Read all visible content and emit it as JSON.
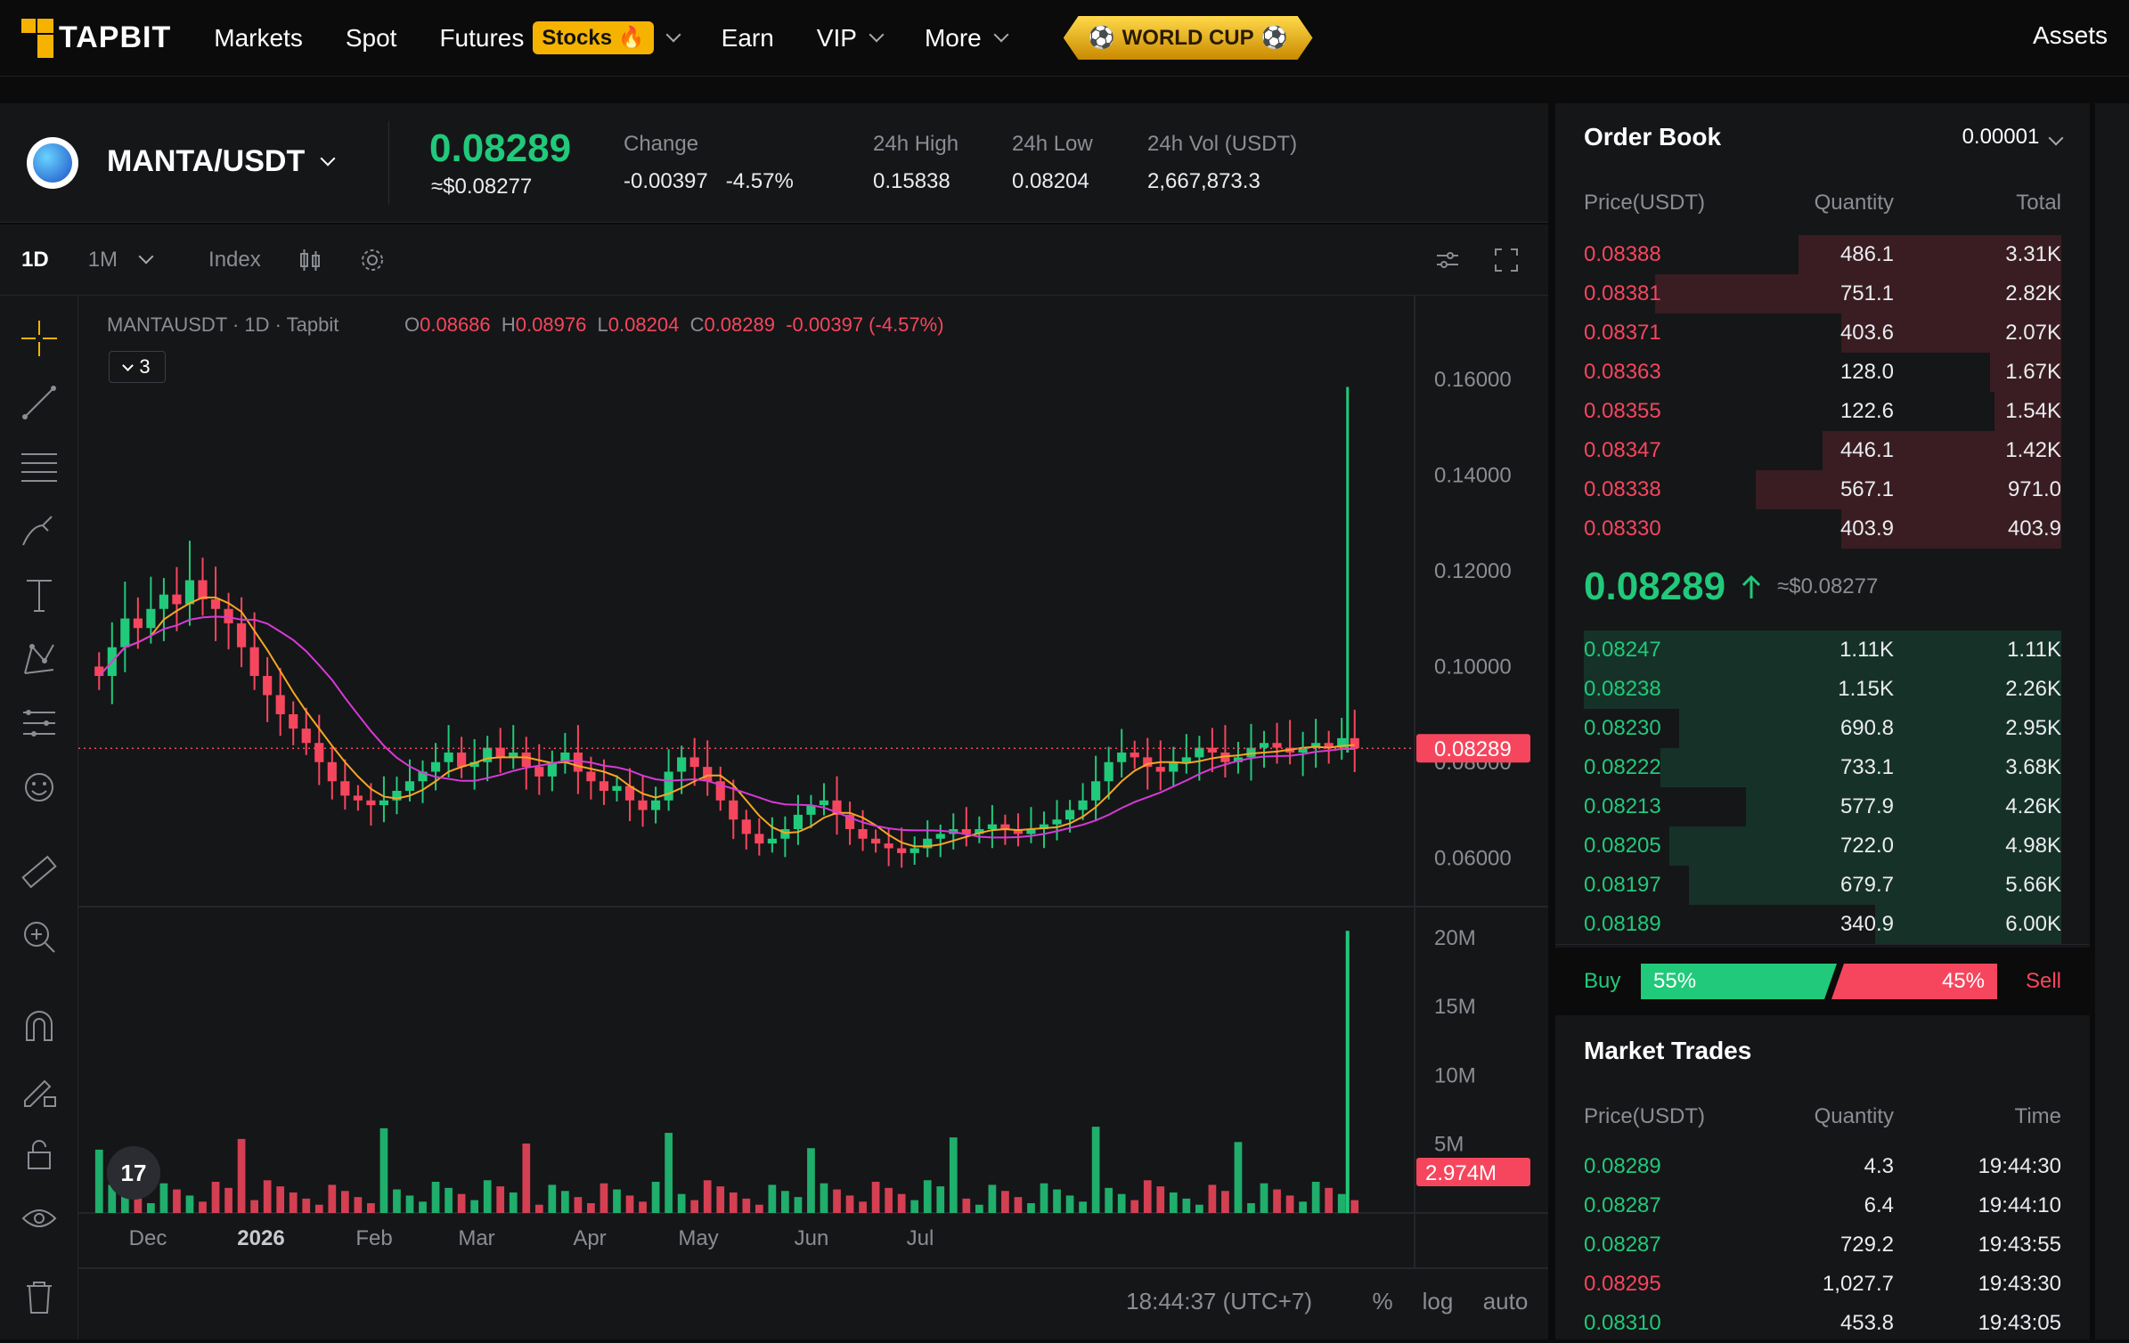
{
  "nav": {
    "logo": "TAPBIT",
    "items": [
      "Markets",
      "Spot",
      "Futures",
      "Earn",
      "VIP",
      "More"
    ],
    "futures_badge": "Stocks 🔥",
    "worldcup": "WORLD CUP",
    "assets": "Assets"
  },
  "ticker": {
    "pair": "MANTA/USDT",
    "price": "0.08289",
    "price_usd": "≈$0.08277",
    "change_label": "Change",
    "change_abs": "-0.00397",
    "change_pct": "-4.57%",
    "high_label": "24h High",
    "high": "0.15838",
    "low_label": "24h Low",
    "low": "0.08204",
    "vol_label": "24h Vol (USDT)",
    "vol": "2,667,873.3"
  },
  "chart_toolbar": {
    "interval": "1D",
    "range": "1M",
    "index": "Index"
  },
  "chart_legend": {
    "symbol": "MANTAUSDT · 1D · Tapbit",
    "o_label": "O",
    "o": "0.08686",
    "h_label": "H",
    "h": "0.08976",
    "l_label": "L",
    "l": "0.08204",
    "c_label": "C",
    "c": "0.08289",
    "chg": "-0.00397 (-4.57%)",
    "collapse_count": "3"
  },
  "chart_data": {
    "type": "candlestick",
    "price_axis": [
      "0.16000",
      "0.14000",
      "0.12000",
      "0.10000",
      "0.08000",
      "0.06000"
    ],
    "ylim": [
      0.05,
      0.17
    ],
    "last_price_label": "0.08289",
    "volume_axis": [
      "20M",
      "15M",
      "10M",
      "5M"
    ],
    "last_volume_label": "2.974M",
    "x_ticks": [
      "Dec",
      "2026",
      "Feb",
      "Mar",
      "Apr",
      "May",
      "Jun",
      "Jul"
    ],
    "close_series": [
      0.098,
      0.104,
      0.11,
      0.108,
      0.112,
      0.115,
      0.113,
      0.118,
      0.114,
      0.112,
      0.109,
      0.104,
      0.098,
      0.094,
      0.09,
      0.087,
      0.084,
      0.08,
      0.076,
      0.073,
      0.072,
      0.071,
      0.072,
      0.074,
      0.076,
      0.078,
      0.08,
      0.082,
      0.079,
      0.08,
      0.083,
      0.081,
      0.082,
      0.079,
      0.077,
      0.08,
      0.082,
      0.078,
      0.076,
      0.074,
      0.075,
      0.072,
      0.07,
      0.072,
      0.078,
      0.081,
      0.079,
      0.076,
      0.072,
      0.068,
      0.065,
      0.063,
      0.064,
      0.066,
      0.069,
      0.071,
      0.072,
      0.069,
      0.066,
      0.064,
      0.063,
      0.062,
      0.061,
      0.062,
      0.064,
      0.065,
      0.066,
      0.065,
      0.066,
      0.067,
      0.066,
      0.065,
      0.066,
      0.067,
      0.068,
      0.07,
      0.072,
      0.076,
      0.08,
      0.082,
      0.081,
      0.079,
      0.078,
      0.08,
      0.081,
      0.083,
      0.082,
      0.08,
      0.081,
      0.083,
      0.084,
      0.083,
      0.082,
      0.083,
      0.084,
      0.083,
      0.085,
      0.08289
    ],
    "time_label": "18:44:37 (UTC+7)",
    "scale_opts": [
      "%",
      "log",
      "auto"
    ]
  },
  "orderbook": {
    "title": "Order Book",
    "precision": "0.00001",
    "headers": [
      "Price(USDT)",
      "Quantity",
      "Total"
    ],
    "asks": [
      {
        "p": "0.08388",
        "q": "486.1",
        "t": "3.31K",
        "depth": 0.55
      },
      {
        "p": "0.08381",
        "q": "751.1",
        "t": "2.82K",
        "depth": 0.85
      },
      {
        "p": "0.08371",
        "q": "403.6",
        "t": "2.07K",
        "depth": 0.46
      },
      {
        "p": "0.08363",
        "q": "128.0",
        "t": "1.67K",
        "depth": 0.15
      },
      {
        "p": "0.08355",
        "q": "122.6",
        "t": "1.54K",
        "depth": 0.14
      },
      {
        "p": "0.08347",
        "q": "446.1",
        "t": "1.42K",
        "depth": 0.5
      },
      {
        "p": "0.08338",
        "q": "567.1",
        "t": "971.0",
        "depth": 0.64
      },
      {
        "p": "0.08330",
        "q": "403.9",
        "t": "403.9",
        "depth": 0.46
      }
    ],
    "mid_price": "0.08289",
    "mid_usd": "≈$0.08277",
    "bids": [
      {
        "p": "0.08247",
        "q": "1.11K",
        "t": "1.11K",
        "depth": 1.0
      },
      {
        "p": "0.08238",
        "q": "1.15K",
        "t": "2.26K",
        "depth": 1.0
      },
      {
        "p": "0.08230",
        "q": "690.8",
        "t": "2.95K",
        "depth": 0.8
      },
      {
        "p": "0.08222",
        "q": "733.1",
        "t": "3.68K",
        "depth": 0.84
      },
      {
        "p": "0.08213",
        "q": "577.9",
        "t": "4.26K",
        "depth": 0.66
      },
      {
        "p": "0.08205",
        "q": "722.0",
        "t": "4.98K",
        "depth": 0.82
      },
      {
        "p": "0.08197",
        "q": "679.7",
        "t": "5.66K",
        "depth": 0.78
      },
      {
        "p": "0.08189",
        "q": "340.9",
        "t": "6.00K",
        "depth": 0.39
      }
    ],
    "buy_label": "Buy",
    "buy_pct": "55%",
    "sell_pct": "45%",
    "sell_label": "Sell",
    "buy_ratio": 0.55
  },
  "trades": {
    "title": "Market Trades",
    "headers": [
      "Price(USDT)",
      "Quantity",
      "Time"
    ],
    "rows": [
      {
        "p": "0.08289",
        "q": "4.3",
        "t": "19:44:30",
        "side": "buy"
      },
      {
        "p": "0.08287",
        "q": "6.4",
        "t": "19:44:10",
        "side": "buy"
      },
      {
        "p": "0.08287",
        "q": "729.2",
        "t": "19:43:55",
        "side": "buy"
      },
      {
        "p": "0.08295",
        "q": "1,027.7",
        "t": "19:43:30",
        "side": "sell"
      },
      {
        "p": "0.08310",
        "q": "453.8",
        "t": "19:43:05",
        "side": "buy"
      }
    ]
  },
  "colors": {
    "up": "#21c97a",
    "down": "#f6465d",
    "accent": "#f5b300"
  }
}
